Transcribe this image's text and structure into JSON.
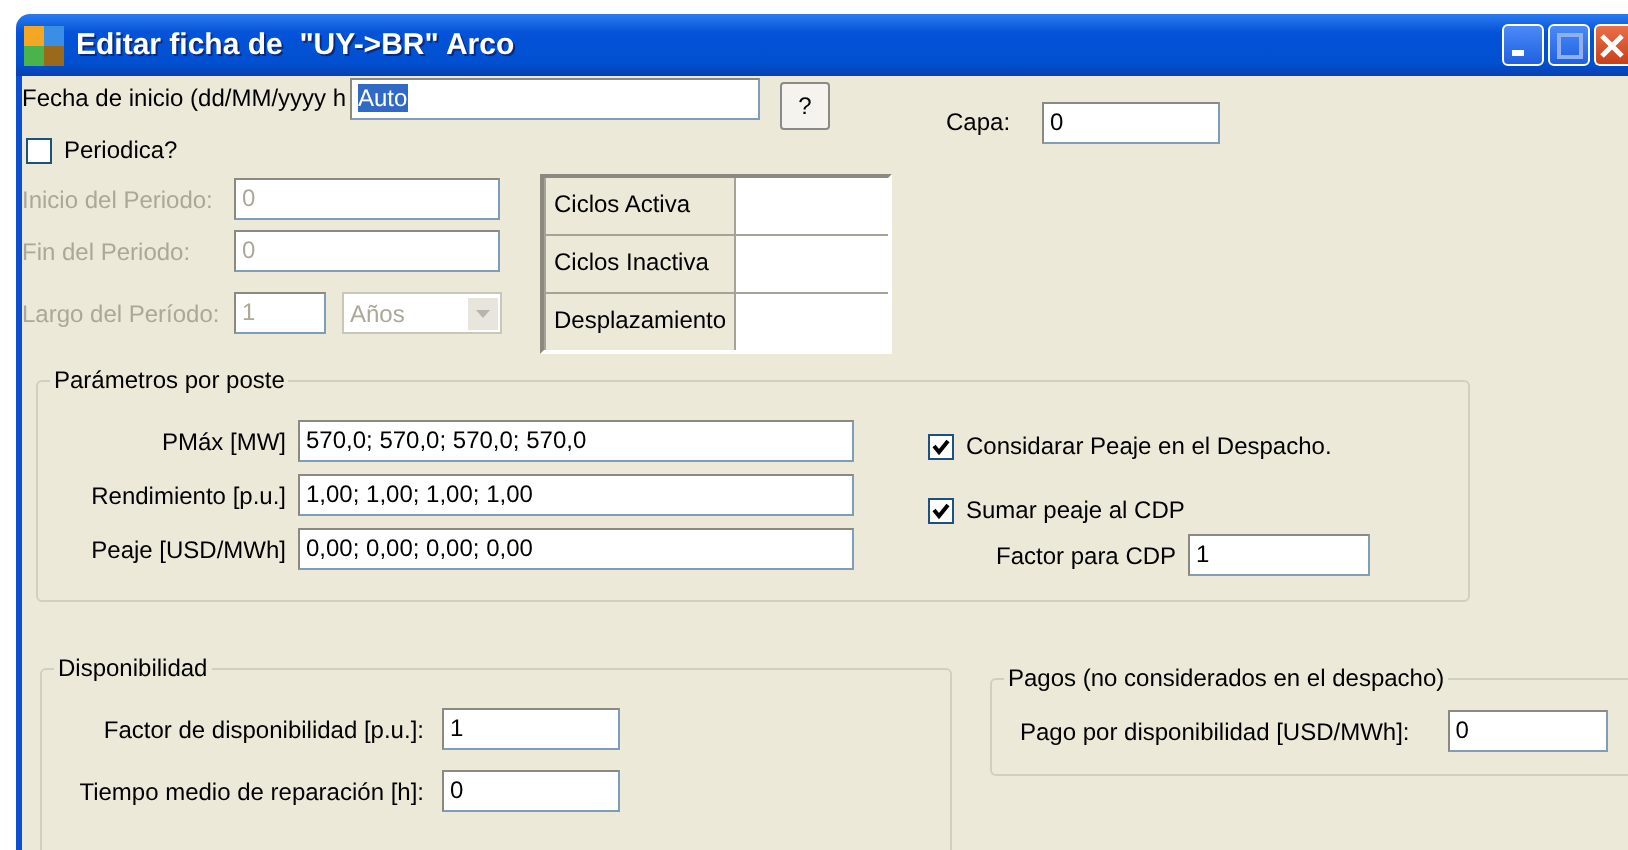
{
  "window": {
    "title": "Editar ficha de  \"UY->BR\" Arco"
  },
  "start_date": {
    "label": "Fecha de inicio (dd/MM/yyyy h",
    "value": "Auto",
    "text_selected": true,
    "help_button": "?"
  },
  "layer": {
    "label": "Capa:",
    "value": "0"
  },
  "periodic": {
    "label": "Periodica?",
    "checked": false
  },
  "period_fields": [
    {
      "label": "Inicio del Periodo:",
      "value": "0",
      "disabled": true
    },
    {
      "label": "Fin del Periodo:",
      "value": "0",
      "disabled": true
    }
  ],
  "period_length": {
    "label": "Largo del Período:",
    "value": "1",
    "unit": "Años",
    "disabled": true
  },
  "cycles_table": {
    "rows": [
      {
        "label": "Ciclos Activa"
      },
      {
        "label": "Ciclos Inactiva"
      },
      {
        "label": "Desplazamiento"
      }
    ]
  },
  "parameters": {
    "title": "Parámetros por poste",
    "fields": [
      {
        "label": "PMáx [MW]",
        "value": "570,0; 570,0; 570,0; 570,0"
      },
      {
        "label": "Rendimiento [p.u.]",
        "value": "1,00; 1,00; 1,00; 1,00"
      },
      {
        "label": "Peaje [USD/MWh]",
        "value": "0,00; 0,00; 0,00; 0,00"
      }
    ],
    "checkboxes": [
      {
        "label": "Considarar Peaje en el Despacho.",
        "checked": true
      },
      {
        "label": "Sumar peaje al CDP",
        "checked": true
      }
    ],
    "cdp_factor": {
      "label": "Factor para CDP",
      "value": "1"
    }
  },
  "availability": {
    "title": "Disponibilidad",
    "fields": [
      {
        "label": "Factor de disponibilidad [p.u.]:",
        "value": "1"
      },
      {
        "label": "Tiempo medio de reparación [h]:",
        "value": "0"
      }
    ]
  },
  "payments": {
    "title": "Pagos (no considerados en el despacho)",
    "fields": [
      {
        "label": "Pago por disponibilidad [USD/MWh]:",
        "value": "0"
      }
    ]
  }
}
